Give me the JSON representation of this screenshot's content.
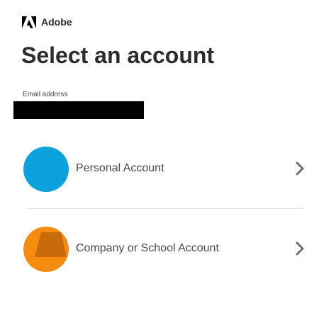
{
  "brand": {
    "icon": "adobe-logo-icon",
    "name": "Adobe"
  },
  "title": "Select an account",
  "email": {
    "label": "Email address",
    "value": ""
  },
  "accounts": [
    {
      "label": "Personal Account",
      "icon": "personal-account-avatar",
      "color": "#0aa1dd"
    },
    {
      "label": "Company or School Account",
      "icon": "company-account-avatar",
      "color": "#f68c0f"
    }
  ],
  "chevron_icon": "chevron-right-icon",
  "colors": {
    "text": "#2c2c2c",
    "label": "#4b4b4b",
    "divider": "#e4e4e4",
    "personal": "#0aa1dd",
    "company": "#f68c0f",
    "company_shade": "#c86b0a"
  }
}
